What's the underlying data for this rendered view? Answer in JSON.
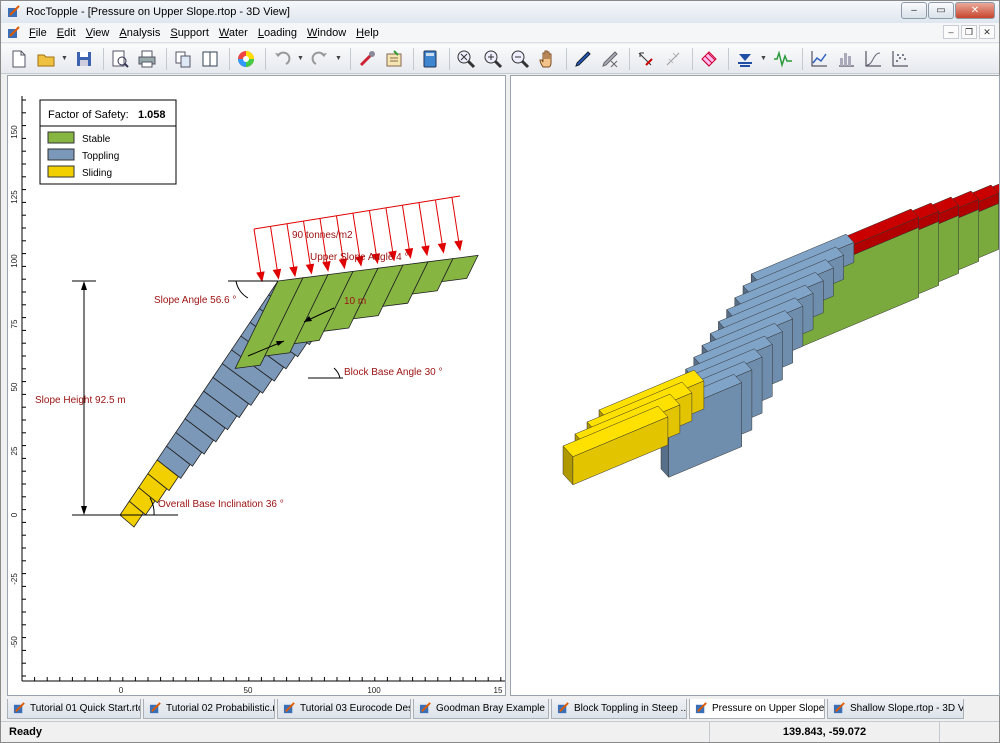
{
  "window": {
    "title": "RocTopple - [Pressure on Upper Slope.rtop - 3D View]",
    "controls": {
      "minimize": "–",
      "restore": "▭",
      "close": "✕"
    }
  },
  "menu": {
    "items": [
      "File",
      "Edit",
      "View",
      "Analysis",
      "Support",
      "Water",
      "Loading",
      "Window",
      "Help"
    ]
  },
  "toolbar": {
    "icons": [
      "new-file-icon",
      "open-folder-icon",
      "save-icon",
      "print-preview-icon",
      "print-icon",
      "copy-icon",
      "tile-view-icon",
      "color-wheel-icon",
      "undo-icon",
      "redo-icon",
      "tools-icon",
      "properties-icon",
      "book-icon",
      "zoom-all-icon",
      "zoom-in-icon",
      "zoom-out-icon",
      "pan-hand-icon",
      "pencil-icon",
      "erase-icon",
      "select-icon",
      "reference-icon",
      "block-icon",
      "water-icon",
      "seismic-icon",
      "chart-icon",
      "histogram-icon",
      "cumulative-icon",
      "scatter-icon"
    ]
  },
  "view2d": {
    "legend": {
      "title": "Factor of Safety:",
      "value": "1.058",
      "items": [
        {
          "label": "Stable",
          "color": "#86b542"
        },
        {
          "label": "Toppling",
          "color": "#7b98b8"
        },
        {
          "label": "Sliding",
          "color": "#f2d000"
        }
      ]
    },
    "annotations": {
      "load": "90 tonnes/m2",
      "upper_slope": "Upper Slope Angle 4 °",
      "slope_angle": "Slope Angle 56.6 °",
      "block_width": "10 m",
      "block_base": "Block Base Angle 30 °",
      "slope_height": "Slope Height  92.5 m",
      "overall_base": "Overall Base Inclination 36 °"
    },
    "y_ticks": [
      "150",
      "125",
      "100",
      "75",
      "50",
      "25",
      "0",
      "-25",
      "-50",
      "-75"
    ],
    "x_ticks": [
      "0",
      "50",
      "100",
      "15"
    ]
  },
  "view3d": {
    "colors": {
      "stable": "#7aaa3e",
      "toppling": "#6f8eae",
      "sliding": "#e2c400",
      "load": "#b00000"
    }
  },
  "tabs": [
    {
      "label": "Tutorial 01 Quick Start.rto...",
      "active": false
    },
    {
      "label": "Tutorial 02 Probabilistic.rt...",
      "active": false
    },
    {
      "label": "Tutorial 03 Eurocode Des...",
      "active": false
    },
    {
      "label": "Goodman Bray Example 2...",
      "active": false
    },
    {
      "label": "Block Toppling in Steep ...",
      "active": false
    },
    {
      "label": "Pressure on Upper Slope....",
      "active": true
    },
    {
      "label": "Shallow Slope.rtop - 3D V...",
      "active": false
    }
  ],
  "status": {
    "text": "Ready",
    "coords": "139.843, -59.072"
  }
}
